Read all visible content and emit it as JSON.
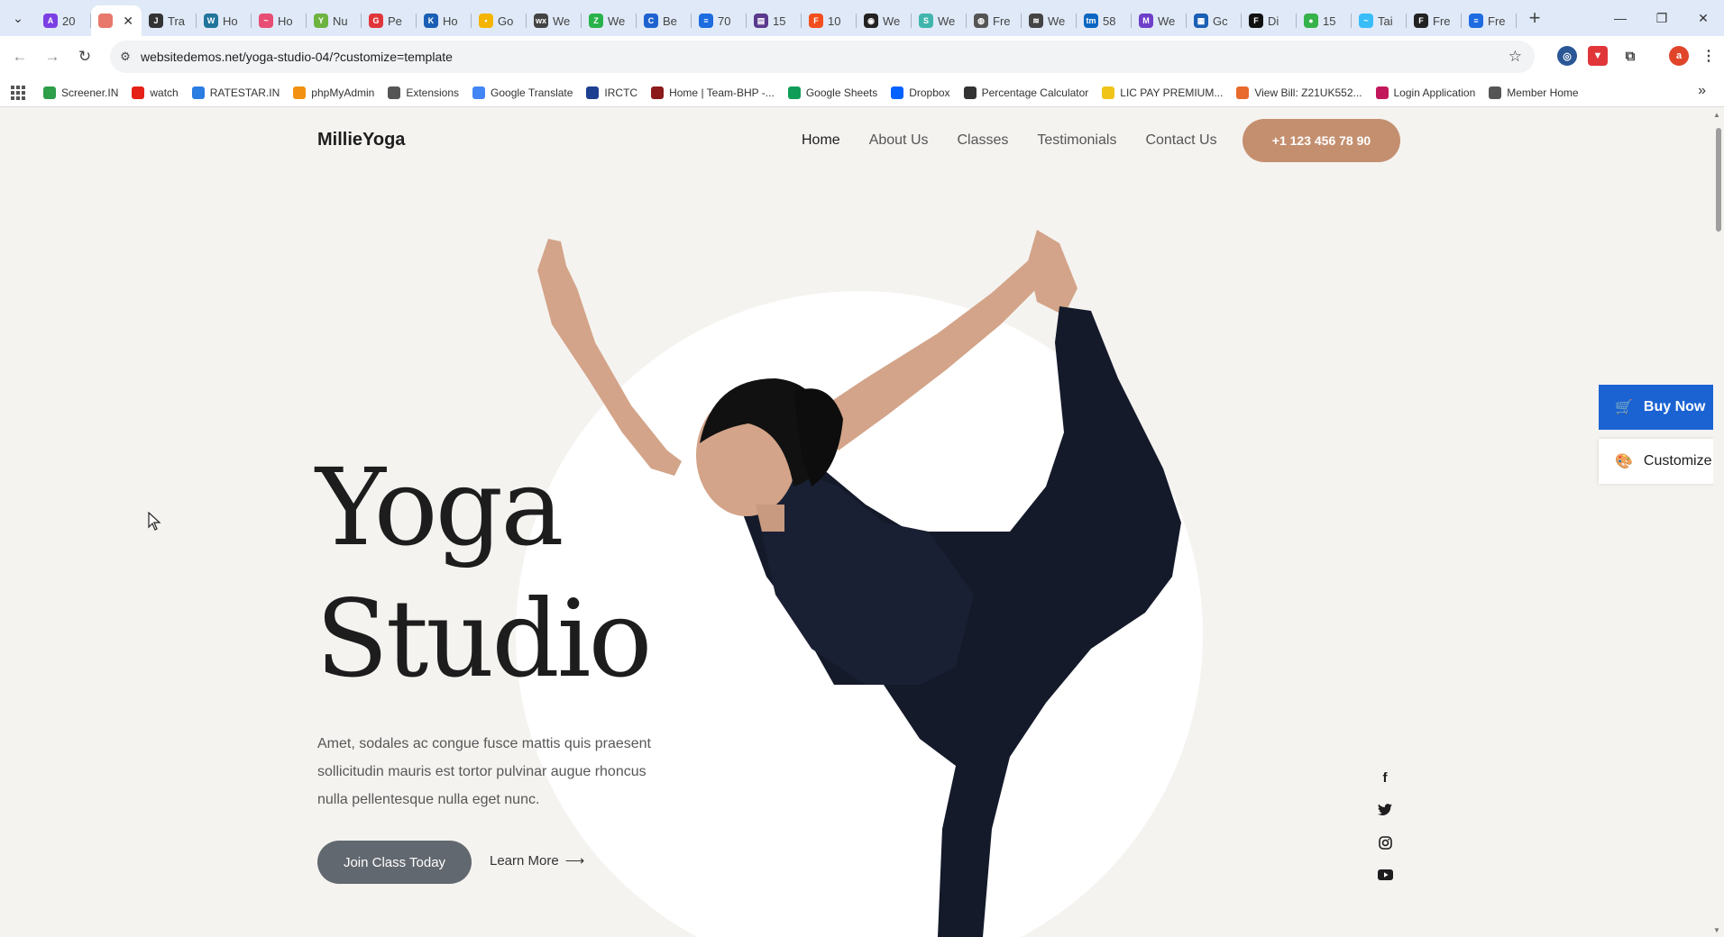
{
  "browser": {
    "tabs": [
      {
        "label": "20",
        "color": "#7b3fe4",
        "icon": "A"
      },
      {
        "label": "",
        "color": "#e8786b",
        "icon": "",
        "active": true
      },
      {
        "label": "Tra",
        "color": "#333333",
        "icon": "J"
      },
      {
        "label": "Ho",
        "color": "#21759b",
        "icon": "W"
      },
      {
        "label": "Ho",
        "color": "#e84d74",
        "icon": "~"
      },
      {
        "label": "Nu",
        "color": "#6db33f",
        "icon": "Y"
      },
      {
        "label": "Pe",
        "color": "#e0363a",
        "icon": "G"
      },
      {
        "label": "Ho",
        "color": "#1a5fb4",
        "icon": "K"
      },
      {
        "label": "Go",
        "color": "#f4b400",
        "icon": "▪"
      },
      {
        "label": "We",
        "color": "#444444",
        "icon": "wx"
      },
      {
        "label": "We",
        "color": "#29b24a",
        "icon": "Z"
      },
      {
        "label": "Be",
        "color": "#1e62d0",
        "icon": "C"
      },
      {
        "label": "70",
        "color": "#1d6ce0",
        "icon": "≡"
      },
      {
        "label": "15",
        "color": "#5b3a8e",
        "icon": "▤"
      },
      {
        "label": "10",
        "color": "#f24e1e",
        "icon": "F"
      },
      {
        "label": "We",
        "color": "#222222",
        "icon": "◉"
      },
      {
        "label": "We",
        "color": "#40b5ac",
        "icon": "S"
      },
      {
        "label": "Fre",
        "color": "#555555",
        "icon": "◍"
      },
      {
        "label": "We",
        "color": "#444444",
        "icon": "≋"
      },
      {
        "label": "58",
        "color": "#0a66c2",
        "icon": "tm"
      },
      {
        "label": "We",
        "color": "#6e40c9",
        "icon": "M"
      },
      {
        "label": "Gc",
        "color": "#1a5fb4",
        "icon": "▦"
      },
      {
        "label": "Di",
        "color": "#111111",
        "icon": "F"
      },
      {
        "label": "15",
        "color": "#36b24a",
        "icon": "●"
      },
      {
        "label": "Tai",
        "color": "#38bdf8",
        "icon": "~"
      },
      {
        "label": "Fre",
        "color": "#222222",
        "icon": "F"
      },
      {
        "label": "Fre",
        "color": "#1d6ce0",
        "icon": "≡"
      }
    ],
    "url": "websitedemos.net/yoga-studio-04/?customize=template",
    "profile_initial": "a",
    "bookmarks": [
      {
        "label": "Screener.IN",
        "color": "#2e9e4b"
      },
      {
        "label": "watch",
        "color": "#e62117"
      },
      {
        "label": "RATESTAR.IN",
        "color": "#2a7de1"
      },
      {
        "label": "phpMyAdmin",
        "color": "#f29111"
      },
      {
        "label": "Extensions",
        "color": "#555555"
      },
      {
        "label": "Google Translate",
        "color": "#4285f4"
      },
      {
        "label": "IRCTC",
        "color": "#1d3f8f"
      },
      {
        "label": "Home | Team-BHP -...",
        "color": "#8b1a1a"
      },
      {
        "label": "Google Sheets",
        "color": "#0f9d58"
      },
      {
        "label": "Dropbox",
        "color": "#0061fe"
      },
      {
        "label": "Percentage Calculator",
        "color": "#333333"
      },
      {
        "label": "LIC PAY PREMIUM...",
        "color": "#f0c419"
      },
      {
        "label": "View Bill: Z21UK552...",
        "color": "#e86a2c"
      },
      {
        "label": "Login Application",
        "color": "#c2185b"
      },
      {
        "label": "Member Home",
        "color": "#555555"
      }
    ]
  },
  "site": {
    "logo": "MillieYoga",
    "nav": [
      "Home",
      "About Us",
      "Classes",
      "Testimonials",
      "Contact Us"
    ],
    "phone": "+1 123 456 78 90",
    "hero_line1": "Yoga",
    "hero_line2": "Studio",
    "description": "Amet, sodales ac congue fusce mattis quis praesent sollicitudin mauris est tortor pulvinar augue rhoncus nulla pellentesque nulla eget nunc.",
    "join_button": "Join Class Today",
    "learn_more": "Learn More",
    "social_icons": [
      "facebook-icon",
      "twitter-icon",
      "instagram-icon",
      "youtube-icon"
    ],
    "buy_now": "Buy Now",
    "customize": "Customize",
    "accent": "#c48f6f",
    "buy_color": "#1b63d3"
  }
}
